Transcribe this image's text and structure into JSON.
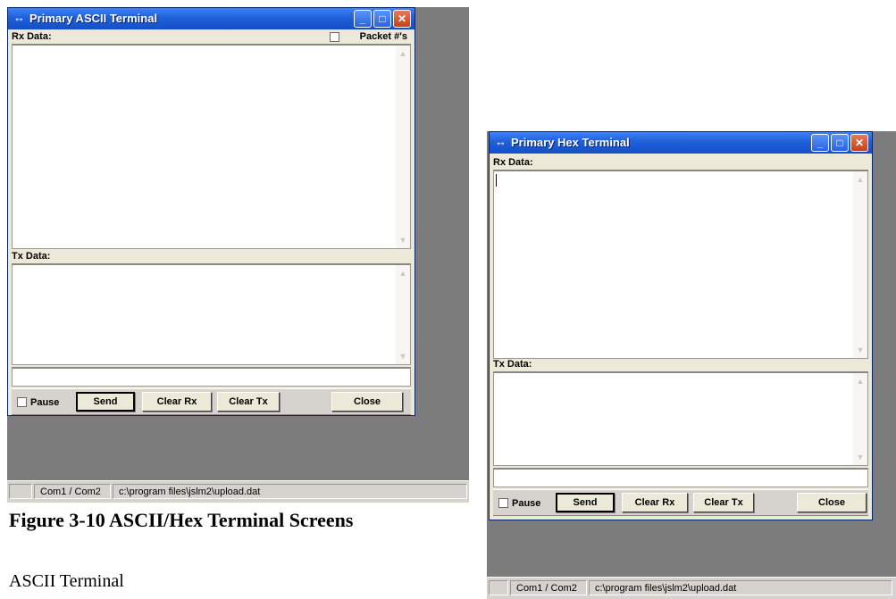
{
  "ascii_window": {
    "title": "Primary ASCII Terminal",
    "rx_label": "Rx Data:",
    "packet_label": "Packet #'s",
    "tx_label": "Tx Data:",
    "pause_label": "Pause",
    "send_label": "Send",
    "clear_rx_label": "Clear Rx",
    "clear_tx_label": "Clear Tx",
    "close_label": "Close",
    "status_port": "Com1 / Com2",
    "status_file": "c:\\program files\\jslm2\\upload.dat"
  },
  "hex_window": {
    "title": "Primary Hex Terminal",
    "rx_label": "Rx Data:",
    "tx_label": "Tx Data:",
    "pause_label": "Pause",
    "send_label": "Send",
    "clear_rx_label": "Clear Rx",
    "clear_tx_label": "Clear Tx",
    "close_label": "Close",
    "status_port": "Com1 / Com2",
    "status_file": "c:\\program files\\jslm2\\upload.dat"
  },
  "figure_caption": "Figure 3-10   ASCII/Hex Terminal Screens",
  "body_text": "ASCII Terminal",
  "icons": [
    "terminal-app-icon",
    "minimize-icon",
    "maximize-icon",
    "close-icon",
    "scroll-up-icon",
    "scroll-down-icon"
  ]
}
